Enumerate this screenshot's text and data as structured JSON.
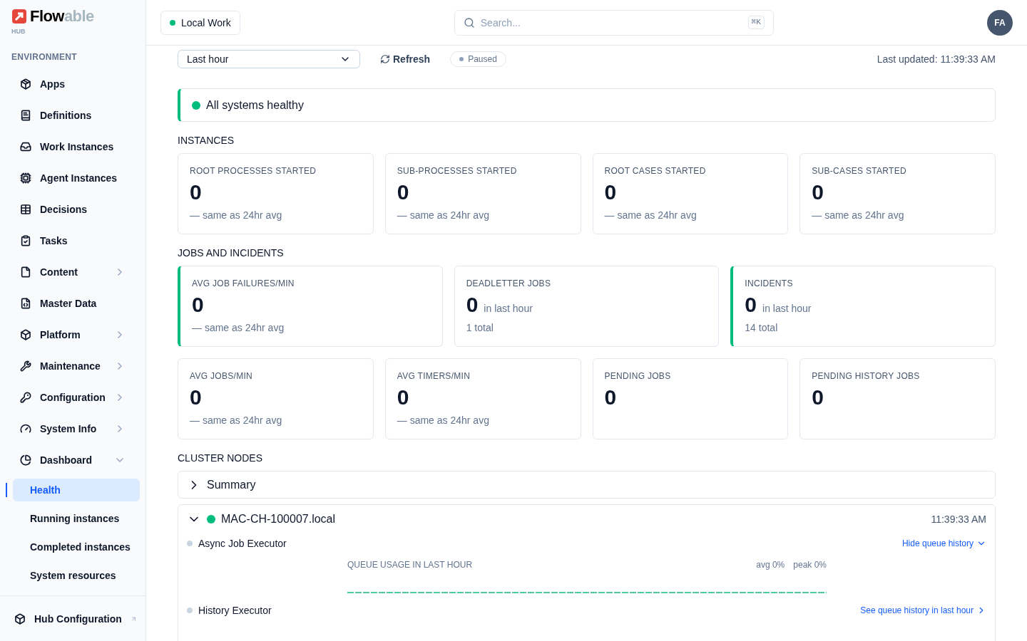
{
  "brand": {
    "name_a": "Flow",
    "name_b": "able",
    "sub": "HUB"
  },
  "sidebar": {
    "section": "ENVIRONMENT",
    "items": [
      {
        "label": "Apps",
        "selected": false
      },
      {
        "label": "Definitions",
        "selected": false
      },
      {
        "label": "Work Instances",
        "selected": false
      },
      {
        "label": "Agent Instances",
        "selected": false
      },
      {
        "label": "Decisions",
        "selected": false
      },
      {
        "label": "Tasks",
        "selected": false
      },
      {
        "label": "Content",
        "expanded": false,
        "selected": false
      },
      {
        "label": "Master Data",
        "selected": false
      },
      {
        "label": "Platform",
        "expanded": false,
        "selected": false
      },
      {
        "label": "Maintenance",
        "expanded": false,
        "selected": false
      },
      {
        "label": "Configuration",
        "expanded": false,
        "selected": false
      },
      {
        "label": "System Info",
        "expanded": false,
        "selected": false
      },
      {
        "label": "Dashboard",
        "expanded": true,
        "selected": false,
        "children": [
          {
            "label": "Health",
            "selected": true
          },
          {
            "label": "Running instances",
            "selected": false
          },
          {
            "label": "Completed instances",
            "selected": false
          },
          {
            "label": "System resources",
            "selected": false
          }
        ]
      }
    ],
    "footer": {
      "label": "Hub Configuration"
    }
  },
  "header": {
    "workspace": "Local Work",
    "search": {
      "placeholder": "Search...",
      "shortcut": "⌘K"
    },
    "avatar": "FA"
  },
  "toolbar": {
    "range": "Last hour",
    "refresh": "Refresh",
    "status": "Paused",
    "updated": "Last updated: 11:39:33 AM"
  },
  "banner": "All systems healthy",
  "sections": [
    {
      "title": "INSTANCES",
      "cards": [
        {
          "label": "ROOT PROCESSES STARTED",
          "value": "0",
          "note": "— same as 24hr avg",
          "accent": false
        },
        {
          "label": "SUB-PROCESSES STARTED",
          "value": "0",
          "note": "— same as 24hr avg",
          "accent": false
        },
        {
          "label": "ROOT CASES STARTED",
          "value": "0",
          "note": "— same as 24hr avg",
          "accent": false
        },
        {
          "label": "SUB-CASES STARTED",
          "value": "0",
          "note": "— same as 24hr avg",
          "accent": false
        }
      ]
    },
    {
      "title": "JOBS AND INCIDENTS",
      "cards": [
        {
          "label": "AVG JOB FAILURES/MIN",
          "value": "0",
          "note": "— same as 24hr avg",
          "accent": true
        },
        {
          "label": "DEADLETTER JOBS",
          "value": "0",
          "suffix": "in last hour",
          "note": "1 total",
          "accent": false
        },
        {
          "label": "INCIDENTS",
          "value": "0",
          "suffix": "in last hour",
          "note": "14 total",
          "accent": true
        }
      ]
    },
    {
      "cards": [
        {
          "label": "AVG JOBS/MIN",
          "value": "0",
          "note": "— same as 24hr avg",
          "accent": false
        },
        {
          "label": "AVG TIMERS/MIN",
          "value": "0",
          "note": "— same as 24hr avg",
          "accent": false
        },
        {
          "label": "PENDING JOBS",
          "value": "0",
          "accent": false
        },
        {
          "label": "PENDING HISTORY JOBS",
          "value": "0",
          "accent": false
        }
      ]
    }
  ],
  "cluster": {
    "title": "CLUSTER NODES",
    "summary": {
      "label": "Summary",
      "expanded": false
    },
    "node": {
      "name": "MAC-CH-100007.local",
      "expanded": true,
      "time": "11:39:33 AM",
      "executors": [
        {
          "name": "Async Job Executor",
          "link": "Hide queue history",
          "expanded": true,
          "chart_title": "QUEUE USAGE IN LAST HOUR",
          "avg": "avg 0%",
          "peak": "peak 0%"
        },
        {
          "name": "History Executor",
          "link": "See queue history in last hour",
          "expanded": false
        }
      ]
    }
  }
}
